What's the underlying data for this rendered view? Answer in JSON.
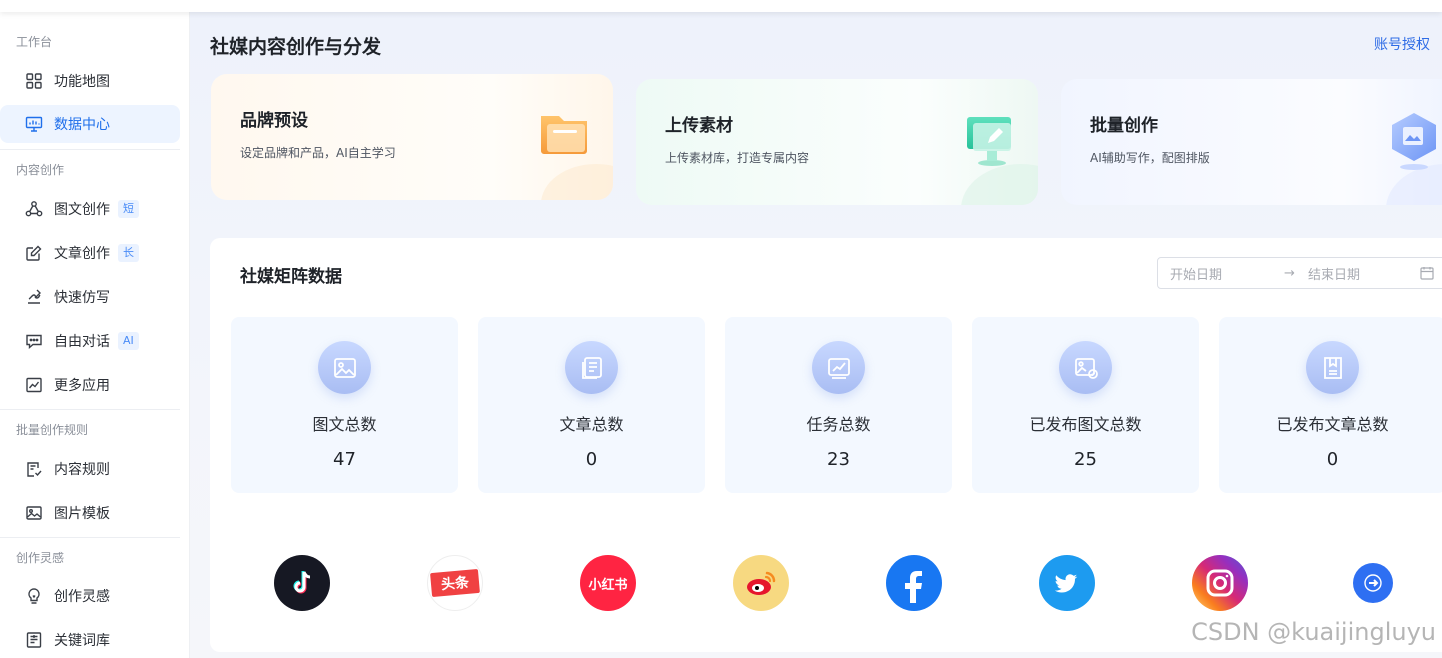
{
  "sidebar": {
    "sections": [
      {
        "title": "工作台",
        "items": [
          {
            "label": "功能地图",
            "icon": "grid-icon"
          },
          {
            "label": "数据中心",
            "icon": "monitor-icon",
            "active": true
          }
        ]
      },
      {
        "title": "内容创作",
        "items": [
          {
            "label": "图文创作",
            "tag": "短",
            "icon": "nodes-icon"
          },
          {
            "label": "文章创作",
            "tag": "长",
            "icon": "edit-note-icon"
          },
          {
            "label": "快速仿写",
            "icon": "quick-write-icon"
          },
          {
            "label": "自由对话",
            "tag": "AI",
            "icon": "chat-icon"
          },
          {
            "label": "更多应用",
            "icon": "chart-app-icon"
          }
        ]
      },
      {
        "title": "批量创作规则",
        "items": [
          {
            "label": "内容规则",
            "icon": "rules-icon"
          },
          {
            "label": "图片模板",
            "icon": "image-template-icon"
          }
        ]
      },
      {
        "title": "创作灵感",
        "items": [
          {
            "label": "创作灵感",
            "icon": "lightbulb-icon"
          },
          {
            "label": "关键词库",
            "icon": "keyword-library-icon"
          }
        ]
      }
    ]
  },
  "header": {
    "title": "社媒内容创作与分发",
    "account_link": "账号授权"
  },
  "feature_cards": [
    {
      "title": "品牌预设",
      "desc": "设定品牌和产品，AI自主学习",
      "icon": "folder-icon"
    },
    {
      "title": "上传素材",
      "desc": "上传素材库，打造专属内容",
      "icon": "upload-monitor-icon"
    },
    {
      "title": "批量创作",
      "desc": "AI辅助写作，配图排版",
      "icon": "batch-image-icon"
    }
  ],
  "panel": {
    "title": "社媒矩阵数据",
    "date_start_placeholder": "开始日期",
    "date_arrow": "→",
    "date_end_placeholder": "结束日期",
    "stats": [
      {
        "label": "图文总数",
        "value": "47",
        "icon": "picture-card-icon"
      },
      {
        "label": "文章总数",
        "value": "0",
        "icon": "document-stack-icon"
      },
      {
        "label": "任务总数",
        "value": "23",
        "icon": "trend-board-icon"
      },
      {
        "label": "已发布图文总数",
        "value": "25",
        "icon": "published-image-icon"
      },
      {
        "label": "已发布文章总数",
        "value": "0",
        "icon": "published-article-icon"
      }
    ],
    "platforms": [
      {
        "name": "tiktok-icon",
        "color": "#161823"
      },
      {
        "name": "toutiao-icon",
        "text": "头条",
        "color": "#f04142"
      },
      {
        "name": "xiaohongshu-icon",
        "text": "小红书",
        "color": "#ff2442"
      },
      {
        "name": "weibo-icon",
        "color": "#f7d981"
      },
      {
        "name": "facebook-icon",
        "color": "#1877f2"
      },
      {
        "name": "twitter-icon",
        "color": "#1d9bf0"
      },
      {
        "name": "instagram-icon",
        "color": "#dd2a7b"
      }
    ]
  },
  "watermark": "CSDN @kuaijingluyu"
}
